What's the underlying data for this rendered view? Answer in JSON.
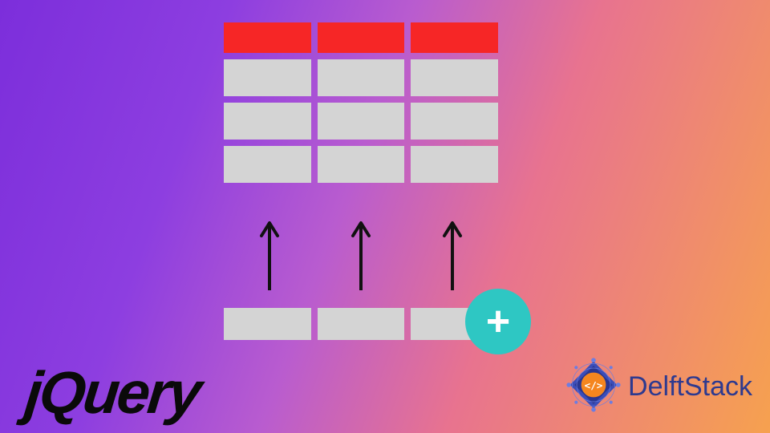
{
  "diagram": {
    "header_color": "#f62626",
    "cell_color": "#d4d4d4",
    "columns": 3,
    "body_rows": 3
  },
  "new_row": {
    "columns": 3
  },
  "add_button": {
    "glyph": "+",
    "bg": "#2ec7c3"
  },
  "jquery_label": "jQuery",
  "delftstack_label": "DelftStack",
  "delft_code_glyph": "</>"
}
